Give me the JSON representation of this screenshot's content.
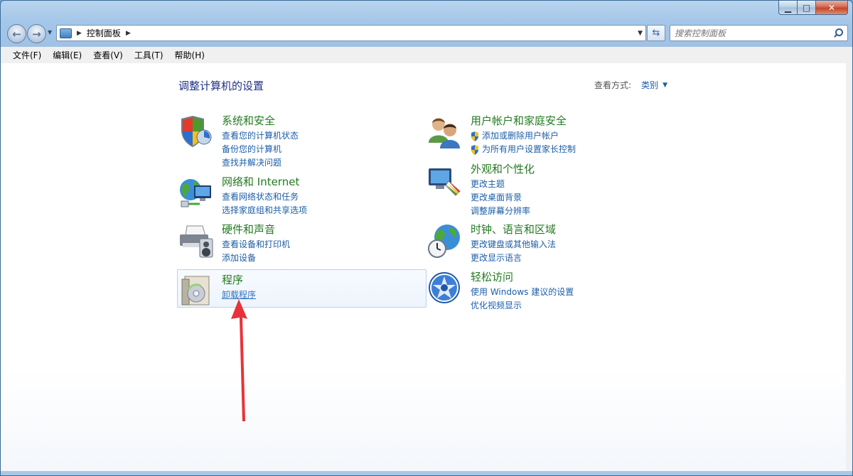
{
  "window": {
    "caption": {
      "minimize": "▁",
      "maximize": "□",
      "close": "✕"
    }
  },
  "navigation": {
    "back_icon": "←",
    "forward_icon": "→",
    "breadcrumb": [
      "控制面板"
    ],
    "search_placeholder": "搜索控制面板"
  },
  "menu": [
    "文件(F)",
    "编辑(E)",
    "查看(V)",
    "工具(T)",
    "帮助(H)"
  ],
  "main": {
    "title": "调整计算机的设置",
    "view_by_label": "查看方式:",
    "view_by_value": "类别",
    "categories_left": [
      {
        "title": "系统和安全",
        "icon": "shield-icon",
        "links": [
          "查看您的计算机状态",
          "备份您的计算机",
          "查找并解决问题"
        ]
      },
      {
        "title": "网络和 Internet",
        "icon": "network-globe-icon",
        "links": [
          "查看网络状态和任务",
          "选择家庭组和共享选项"
        ]
      },
      {
        "title": "硬件和声音",
        "icon": "printer-icon",
        "links": [
          "查看设备和打印机",
          "添加设备"
        ]
      },
      {
        "title": "程序",
        "icon": "programs-icon",
        "links": [
          "卸载程序"
        ]
      }
    ],
    "categories_right": [
      {
        "title": "用户帐户和家庭安全",
        "icon": "users-icon",
        "links": [
          "添加或删除用户帐户",
          "为所有用户设置家长控制"
        ]
      },
      {
        "title": "外观和个性化",
        "icon": "monitor-palette-icon",
        "links": [
          "更改主题",
          "更改桌面背景",
          "调整屏幕分辨率"
        ]
      },
      {
        "title": "时钟、语言和区域",
        "icon": "globe-clock-icon",
        "links": [
          "更改键盘或其他输入法",
          "更改显示语言"
        ]
      },
      {
        "title": "轻松访问",
        "icon": "ease-of-access-icon",
        "links": [
          "使用 Windows 建议的设置",
          "优化视频显示"
        ]
      }
    ]
  },
  "annotation": {
    "color": "#e8323a"
  }
}
